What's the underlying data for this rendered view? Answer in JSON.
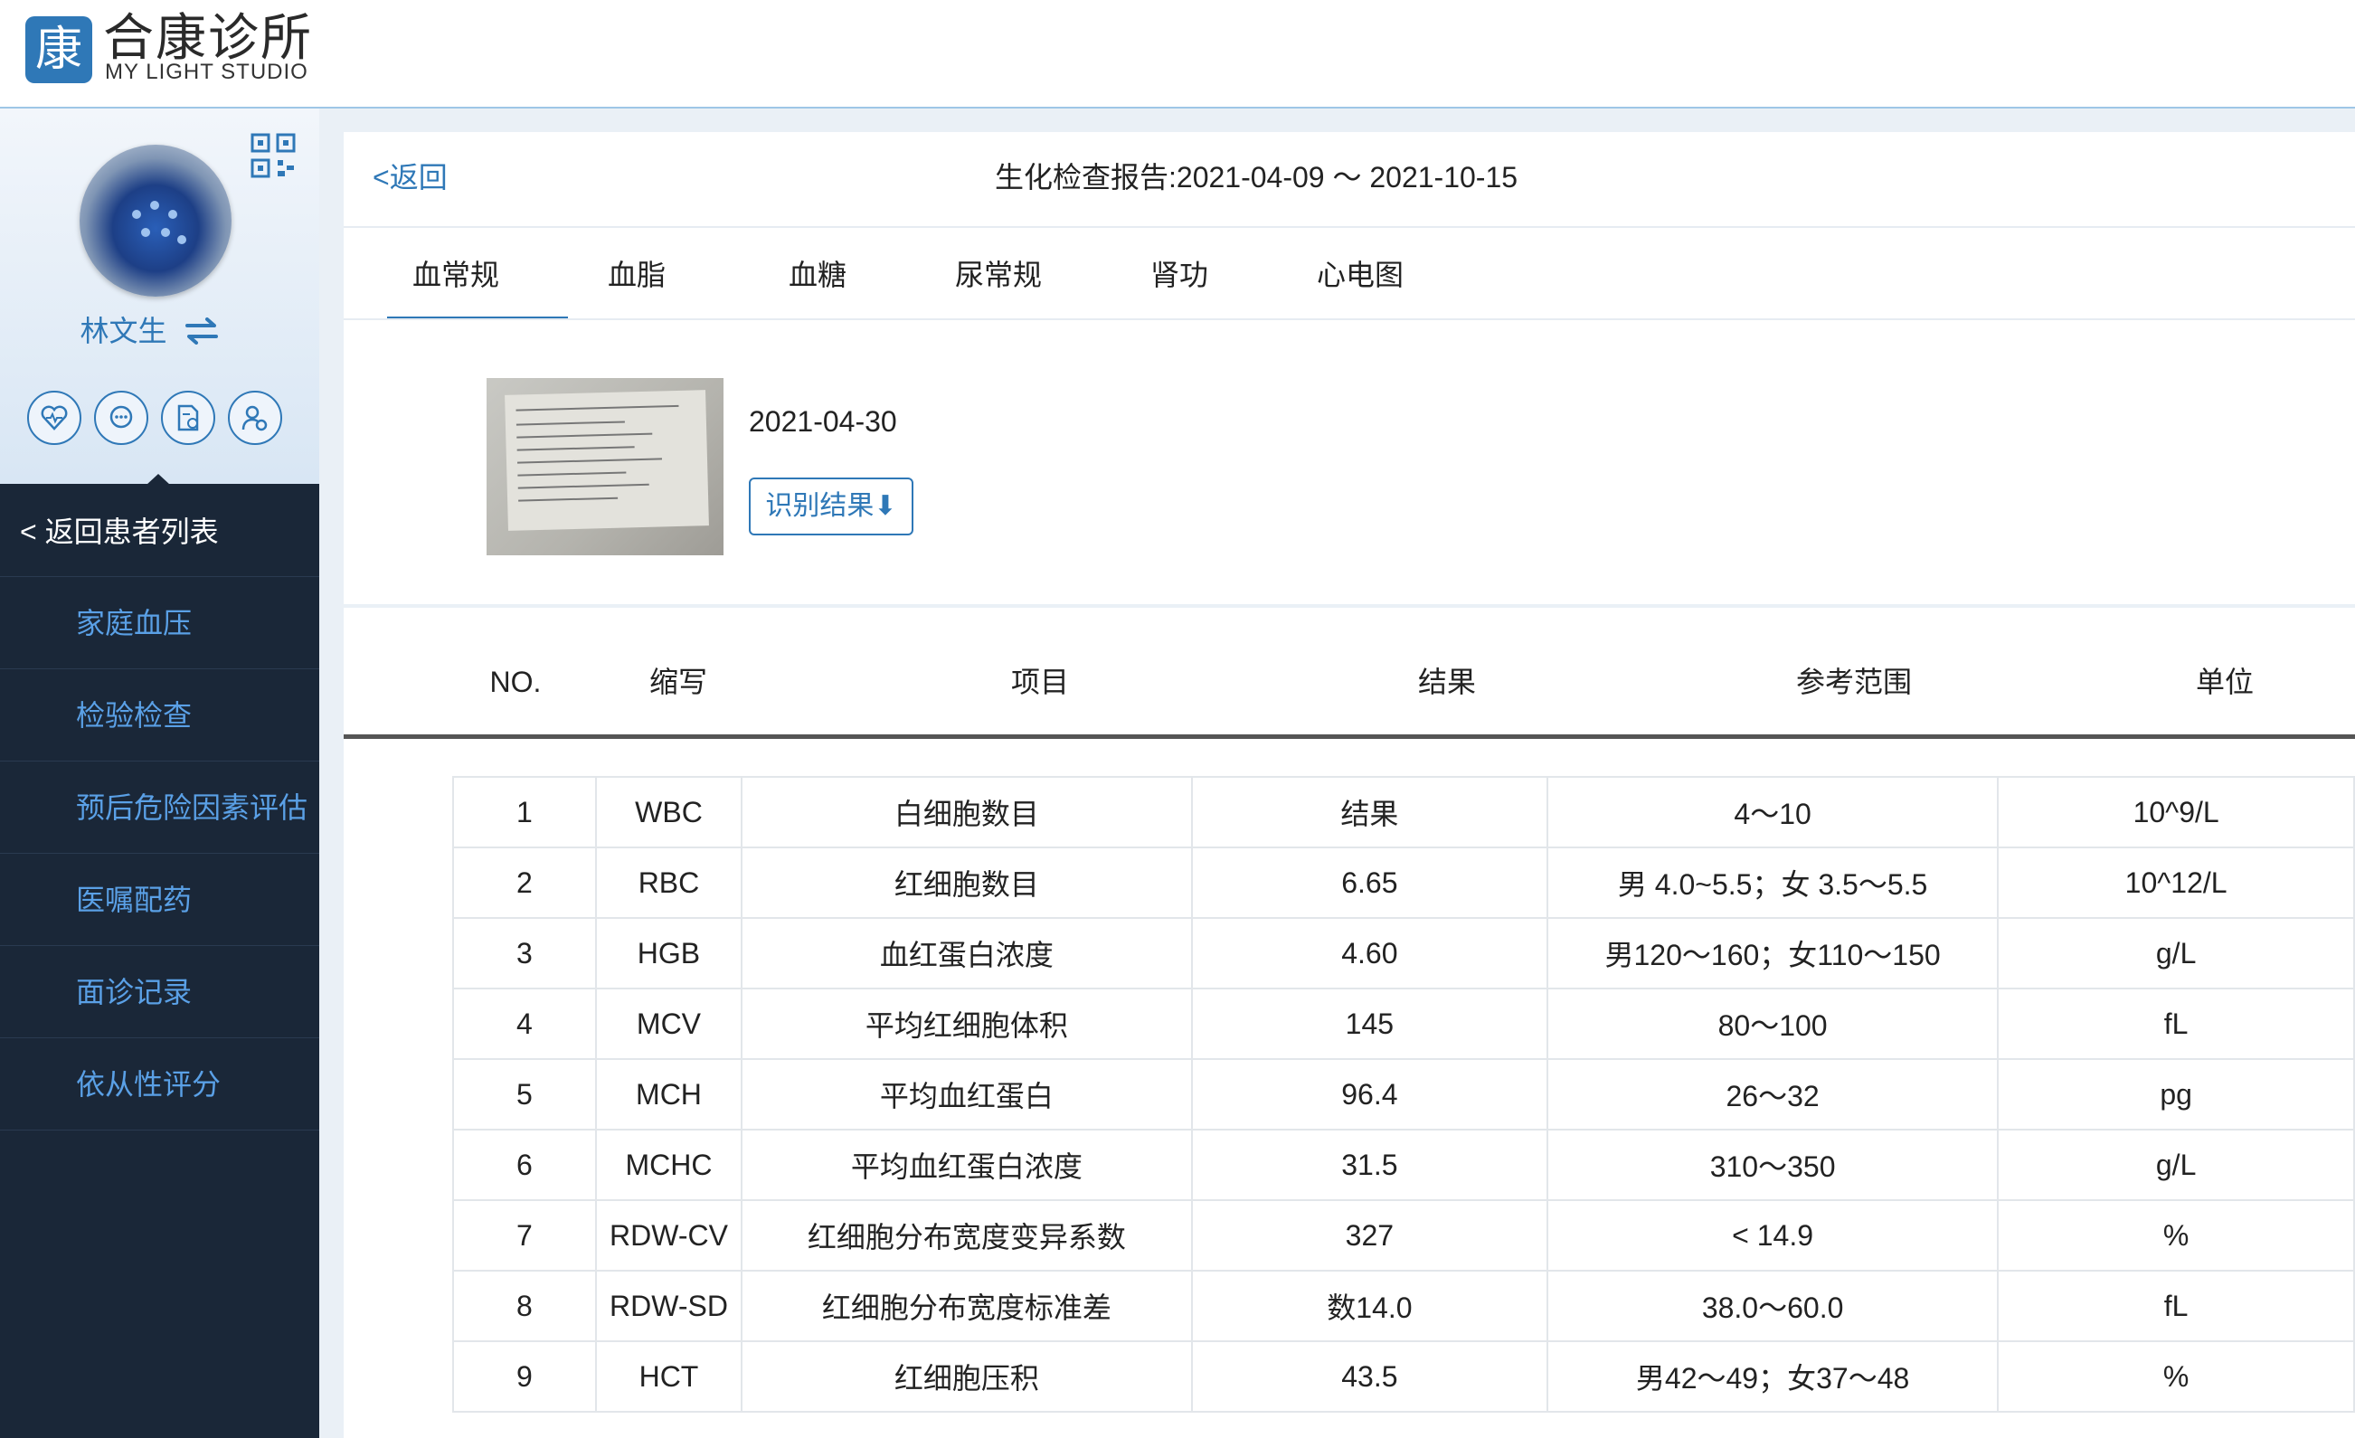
{
  "app": {
    "logo_char": "康",
    "title": "合康诊所",
    "subtitle": "MY LIGHT STUDIO"
  },
  "sidebar": {
    "patient_name": "林文生",
    "back_label": "< 返回患者列表",
    "items": [
      {
        "label": "家庭血压"
      },
      {
        "label": "检验检查"
      },
      {
        "label": "预后危险因素评估"
      },
      {
        "label": "医嘱配药"
      },
      {
        "label": "面诊记录"
      },
      {
        "label": "依从性评分"
      }
    ]
  },
  "report": {
    "back_label": "<返回",
    "title": "生化检查报告:2021-04-09 ～ 2021-10-15",
    "tabs": [
      {
        "label": "血常规",
        "active": true
      },
      {
        "label": "血脂"
      },
      {
        "label": "血糖"
      },
      {
        "label": "尿常规"
      },
      {
        "label": "肾功"
      },
      {
        "label": "心电图"
      }
    ],
    "date": "2021-04-30",
    "recognize_label": "识别结果⬇"
  },
  "table": {
    "headers": [
      "NO.",
      "缩写",
      "项目",
      "结果",
      "参考范围",
      "单位"
    ],
    "rows": [
      {
        "no": "1",
        "abbr": "WBC",
        "item": "白细胞数目",
        "result": "结果",
        "range": "4～10",
        "unit": "10^9/L"
      },
      {
        "no": "2",
        "abbr": "RBC",
        "item": "红细胞数目",
        "result": "6.65",
        "range": "男 4.0~5.5；女 3.5～5.5",
        "unit": "10^12/L"
      },
      {
        "no": "3",
        "abbr": "HGB",
        "item": "血红蛋白浓度",
        "result": "4.60",
        "range": "男120～160；女110～150",
        "unit": "g/L"
      },
      {
        "no": "4",
        "abbr": "MCV",
        "item": "平均红细胞体积",
        "result": "145",
        "range": "80～100",
        "unit": "fL"
      },
      {
        "no": "5",
        "abbr": "MCH",
        "item": "平均血红蛋白",
        "result": "96.4",
        "range": "26～32",
        "unit": "pg"
      },
      {
        "no": "6",
        "abbr": "MCHC",
        "item": "平均血红蛋白浓度",
        "result": "31.5",
        "range": "310～350",
        "unit": "g/L"
      },
      {
        "no": "7",
        "abbr": "RDW-CV",
        "item": "红细胞分布宽度变异系数",
        "result": "327",
        "range": "< 14.9",
        "unit": "%"
      },
      {
        "no": "8",
        "abbr": "RDW-SD",
        "item": "红细胞分布宽度标准差",
        "result": "数14.0",
        "range": "38.0～60.0",
        "unit": "fL"
      },
      {
        "no": "9",
        "abbr": "HCT",
        "item": "红细胞压积",
        "result": "43.5",
        "range": "男42～49；女37～48",
        "unit": "%"
      }
    ]
  },
  "colors": {
    "accent": "#2f78b7",
    "sidebar_bg": "#1a2738",
    "nav_text": "#5aa0e6"
  }
}
